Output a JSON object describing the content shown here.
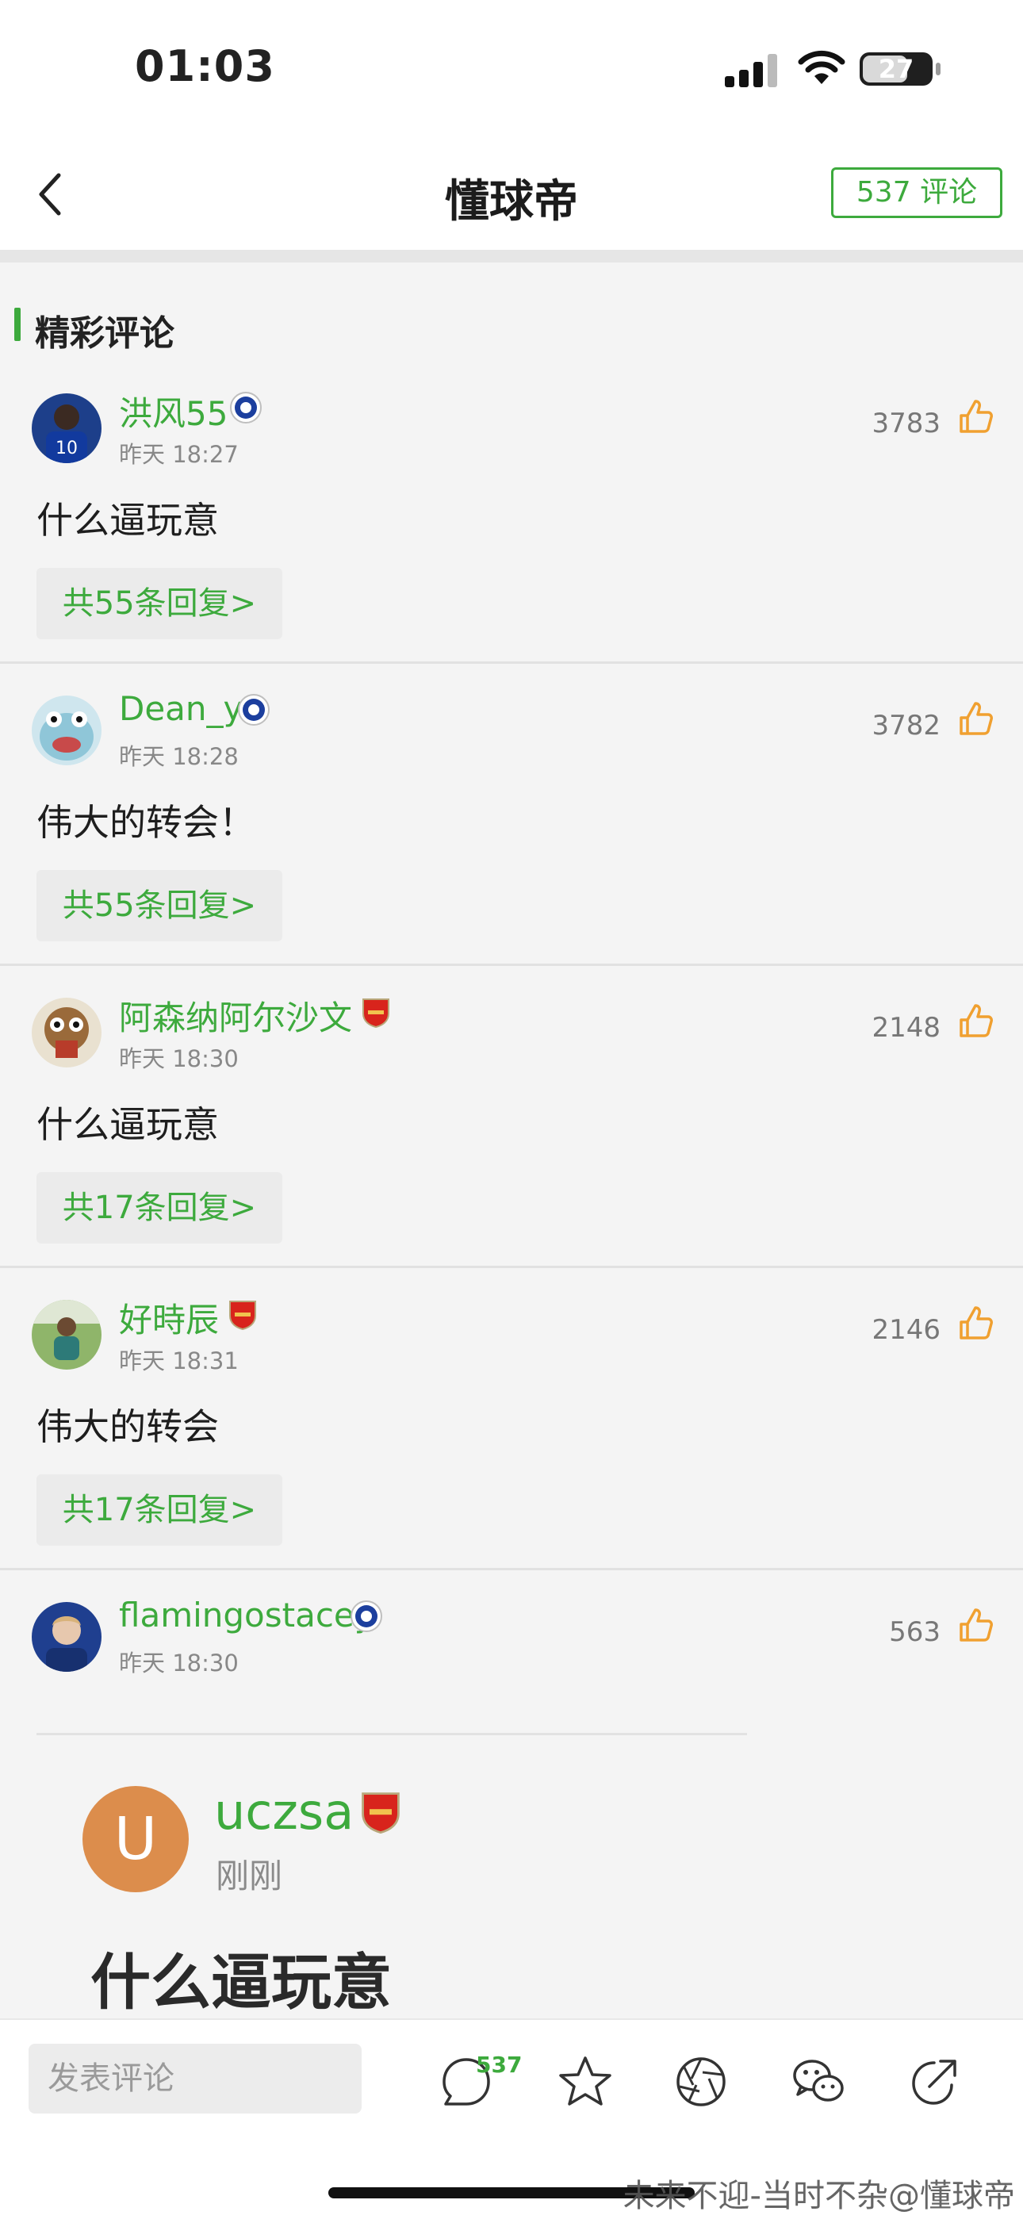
{
  "status_bar": {
    "time": "01:03",
    "battery": "27"
  },
  "header": {
    "title": "懂球帝",
    "comment_count_button": "537 评论"
  },
  "section": {
    "title": "精彩评论"
  },
  "comments": [
    {
      "name": "洪风55",
      "club": "chelsea",
      "time": "昨天 18:27",
      "likes": "3783",
      "text": "什么逼玩意",
      "replies": "共55条回复>"
    },
    {
      "name": "Dean_y",
      "club": "chelsea",
      "time": "昨天 18:28",
      "likes": "3782",
      "text": "伟大的转会！",
      "replies": "共55条回复>"
    },
    {
      "name": "阿森纳阿尔沙文",
      "club": "arsenal",
      "time": "昨天 18:30",
      "likes": "2148",
      "text": "什么逼玩意",
      "replies": "共17条回复>"
    },
    {
      "name": "好時辰",
      "club": "arsenal",
      "time": "昨天 18:31",
      "likes": "2146",
      "text": "伟大的转会",
      "replies": "共17条回复>"
    },
    {
      "name": "flamingostacey",
      "club": "chelsea",
      "time": "昨天 18:30",
      "likes": "563"
    }
  ],
  "embedded": {
    "avatar_letter": "U",
    "name": "uczsa",
    "time": "刚刚",
    "text": "什么逼玩意",
    "avatar_color": "#dc8d4c"
  },
  "bottom_bar": {
    "input_placeholder": "发表评论",
    "comment_count": "537"
  },
  "watermark": "未来不迎-当时不杂@懂球帝",
  "colors": {
    "accent_green": "#3daa3d",
    "like_orange": "#f0a030"
  }
}
